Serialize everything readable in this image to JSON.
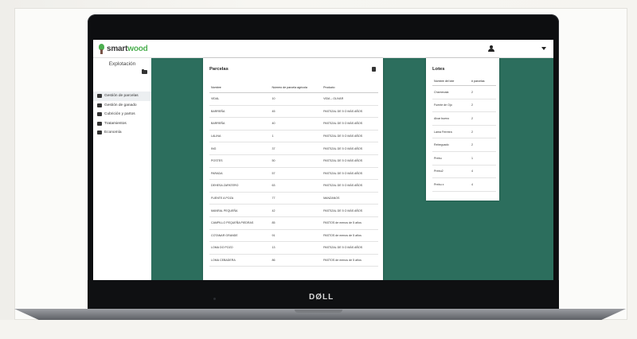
{
  "app": {
    "logo_part1": "smart",
    "logo_part2": "wood",
    "accent_color": "#4caf50",
    "teal_color": "#2c6e5d"
  },
  "header": {
    "user_icon": "user-icon",
    "menu_icon": "caret-down-icon"
  },
  "sidebar": {
    "title": "Explotación",
    "folder_icon": "folder-icon",
    "items": [
      {
        "label": "Gestión de parcelas",
        "icon": "map-icon",
        "active": true
      },
      {
        "label": "Gestión de ganado",
        "icon": "cow-icon",
        "active": false
      },
      {
        "label": "Cubrición y partos",
        "icon": "gender-icon",
        "active": false
      },
      {
        "label": "Tratamientos",
        "icon": "medkit-icon",
        "active": false
      },
      {
        "label": "Economía",
        "icon": "chart-icon",
        "active": false
      }
    ]
  },
  "parcelas": {
    "title": "Parcelas",
    "export_icon": "pdf-icon",
    "columns": [
      "Nombre",
      "Número de parcela agrícola",
      "Producto"
    ],
    "rows": [
      [
        "VIDAL",
        "10",
        "VIDA – OLIVAR"
      ],
      [
        "BARREÑA",
        "45",
        "PASTIZAL DE 5 O MÁS AÑOS"
      ],
      [
        "BARREÑA",
        "40",
        "PASTIZAL DE 5 O MÁS AÑOS"
      ],
      [
        "LALINA",
        "1",
        "PASTIZAL DE 5 O MÁS AÑOS"
      ],
      [
        "ING",
        "37",
        "PASTIZAL DE 5 O MÁS AÑOS"
      ],
      [
        "POSTES",
        "50",
        "PASTIZAL DE 5 O MÁS AÑOS"
      ],
      [
        "PARADA",
        "57",
        "PASTIZAL DE 5 O MÁS AÑOS"
      ],
      [
        "DEHESA ZAPATERO",
        "63",
        "PASTIZAL DE 5 O MÁS AÑOS"
      ],
      [
        "FUENTE A POZA",
        "77",
        "MANZANOS"
      ],
      [
        "MANRAL PEQUEÑA",
        "42",
        "PASTIZAL DE 5 O MÁS AÑOS"
      ],
      [
        "CAMPILLO PEQUEÑA PIEDRAS",
        "85",
        "PASTOS de menos de 5 años"
      ],
      [
        "COTANAR GRANDE",
        "91",
        "PASTOS de menos de 5 años"
      ],
      [
        "LOMA DO POZO",
        "13",
        "PASTIZAL DE 5 O MÁS AÑOS"
      ],
      [
        "LOMA CEBADERA",
        "86",
        "PASTOS de menos de 5 años"
      ]
    ]
  },
  "lotes": {
    "title": "Lotes",
    "columns": [
      "Nombre del lote",
      "# parcelas"
    ],
    "rows": [
      [
        "Charnecala",
        "2"
      ],
      [
        "Fuente de Ojo",
        "2"
      ],
      [
        "Alvar bueno",
        "2"
      ],
      [
        "Lama Ferreira",
        "2"
      ],
      [
        "Rebeguado",
        "2"
      ],
      [
        "Prebu",
        "1"
      ],
      [
        "Prebu2",
        "4"
      ],
      [
        "Prebu x",
        "4"
      ]
    ]
  },
  "device": {
    "brand": "DØLL"
  }
}
